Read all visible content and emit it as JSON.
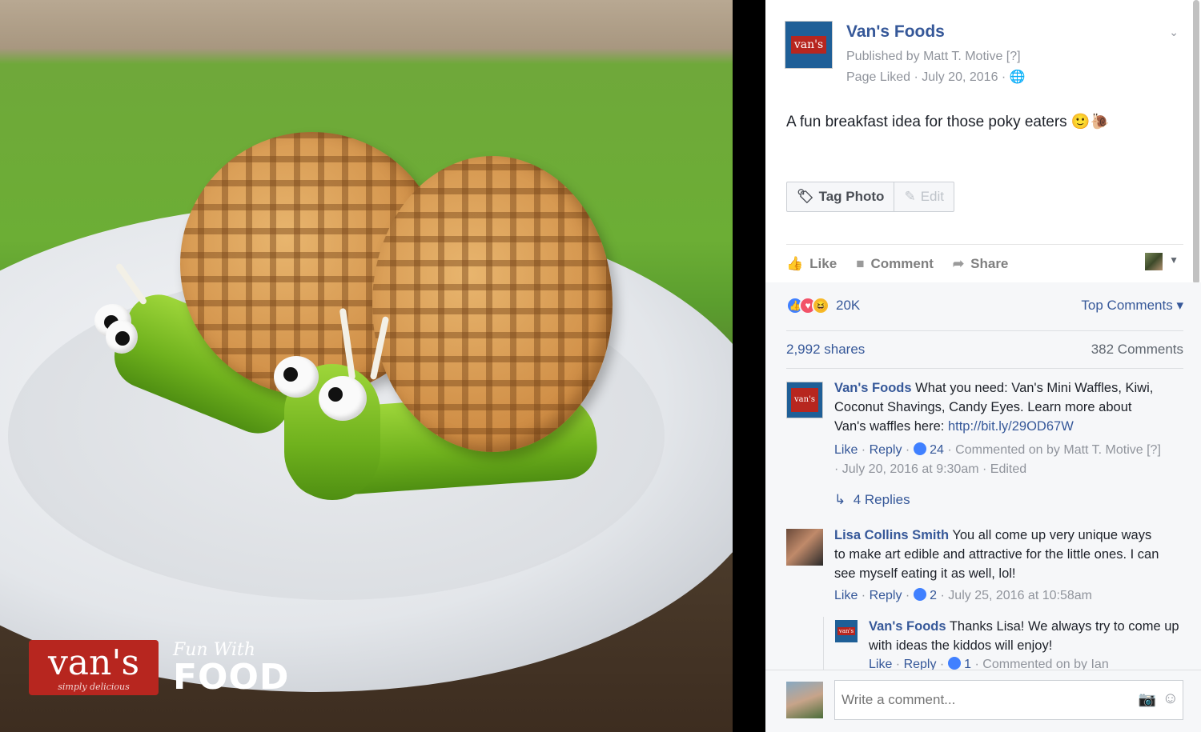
{
  "photo": {
    "brand_name": "van's",
    "brand_tagline": "simply delicious",
    "brand_fun": "Fun With",
    "brand_food": "FOOD"
  },
  "post": {
    "page_name": "Van's Foods",
    "page_thumb_text": "van's",
    "published_by": "Published by Matt T. Motive [?]",
    "page_liked": "Page Liked · July 20, 2016 · ",
    "caption": "A fun breakfast idea for those poky eaters 🙂🐌",
    "tag_photo_label": "Tag Photo",
    "edit_label": "Edit"
  },
  "actions": {
    "like": "Like",
    "comment": "Comment",
    "share": "Share"
  },
  "social": {
    "reaction_count": "20K",
    "top_comments": "Top Comments",
    "shares": "2,992 shares",
    "comments_count": "382 Comments"
  },
  "comments": [
    {
      "author": "Van's Foods",
      "text": "What you need: Van's Mini Waffles, Kiwi, Coconut Shavings, Candy Eyes. Learn more about Van's waffles here: ",
      "link": "http://bit.ly/29OD67W",
      "like": "Like",
      "reply": "Reply",
      "likes": "24",
      "meta": "· Commented on by Matt T. Motive [?] · July 20, 2016 at 9:30am · Edited"
    },
    {
      "author": "Lisa Collins Smith",
      "text": "You all come up very unique ways to make art edible and attractive for the little ones. I can see myself eating it as well, lol!",
      "like": "Like",
      "reply": "Reply",
      "likes": "2",
      "meta": "· July 25, 2016 at 10:58am"
    }
  ],
  "replies_link": "4 Replies",
  "reply": {
    "author": "Van's Foods",
    "text": "Thanks Lisa! We always try to come up with ideas the kiddos will enjoy!",
    "like": "Like",
    "reply": "Reply",
    "likes": "1",
    "meta": "· Commented on by Ian"
  },
  "composer": {
    "placeholder": "Write a comment..."
  },
  "colors": {
    "link": "#365899",
    "brand_red": "#b7261f",
    "like_blue": "#4080ff",
    "love_red": "#f25268",
    "haha_yellow": "#f7b928"
  },
  "icons": [
    "chevron-down-icon",
    "tag-icon",
    "pencil-icon",
    "thumbs-up-icon",
    "comment-icon",
    "share-icon",
    "like-reaction-icon",
    "love-reaction-icon",
    "haha-reaction-icon",
    "reply-arrow-icon",
    "camera-icon",
    "smile-icon"
  ]
}
